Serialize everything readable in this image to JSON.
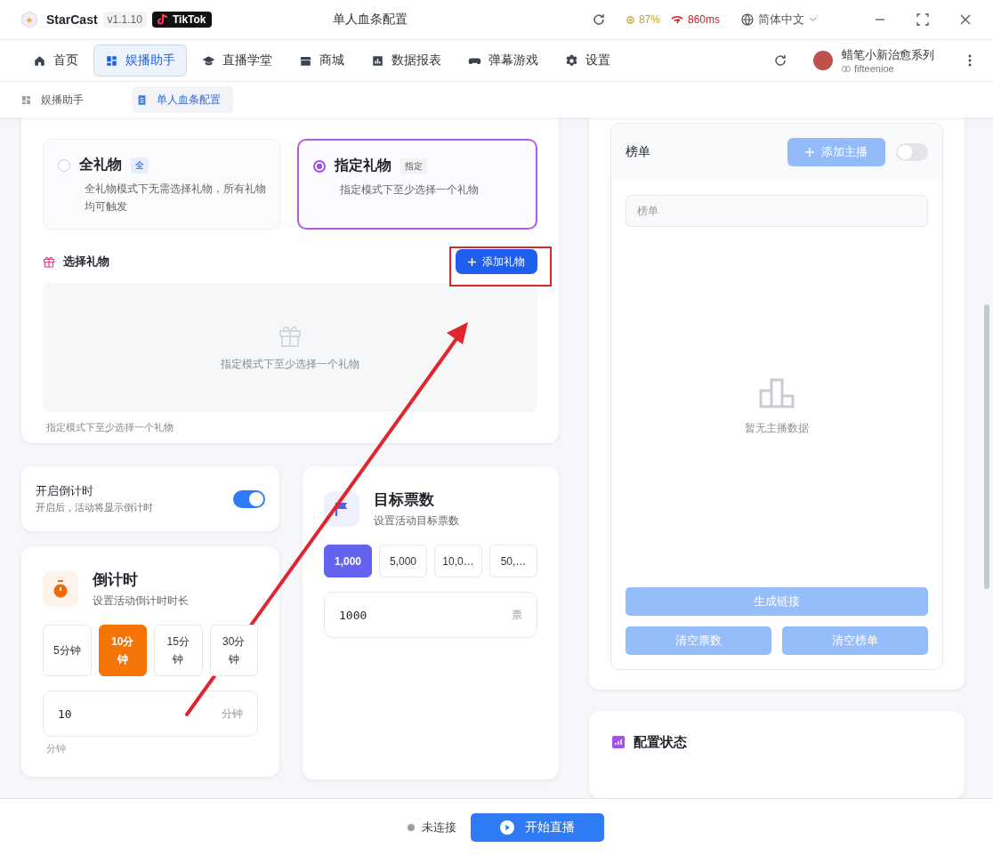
{
  "app": {
    "name": "StarCast",
    "version": "v1.1.10",
    "platform": "TikTok",
    "window_title": "单人血条配置",
    "battery": "87%",
    "latency": "860ms",
    "language": "简体中文"
  },
  "nav": {
    "items": [
      {
        "label": "首页",
        "selected": false
      },
      {
        "label": "娱播助手",
        "selected": true
      },
      {
        "label": "直播学堂",
        "selected": false
      },
      {
        "label": "商城",
        "selected": false
      },
      {
        "label": "数据报表",
        "selected": false
      },
      {
        "label": "弹幕游戏",
        "selected": false
      },
      {
        "label": "设置",
        "selected": false
      }
    ],
    "user": {
      "name": "蜡笔小新治愈系列",
      "handle": "fifteenioe"
    }
  },
  "tabs": [
    {
      "label": "娱播助手",
      "selected": false
    },
    {
      "label": "单人血条配置",
      "selected": true
    }
  ],
  "gift_mode": {
    "options": [
      {
        "title": "全礼物",
        "badge": "全",
        "description": "全礼物模式下无需选择礼物，所有礼物均可触发",
        "selected": false
      },
      {
        "title": "指定礼物",
        "badge": "指定",
        "description": "指定模式下至少选择一个礼物",
        "selected": true
      }
    ]
  },
  "gift_select": {
    "title": "选择礼物",
    "add_button": "添加礼物",
    "empty_text": "指定模式下至少选择一个礼物",
    "hint": "指定模式下至少选择一个礼物"
  },
  "countdown_toggle": {
    "label": "开启倒计时",
    "description": "开启后，活动将显示倒计时",
    "on": true
  },
  "countdown": {
    "title": "倒计时",
    "subtitle": "设置活动倒计时时长",
    "presets": [
      {
        "label": "5分钟",
        "selected": false
      },
      {
        "label": "10分钟",
        "selected": true
      },
      {
        "label": "15分钟",
        "selected": false
      },
      {
        "label": "30分钟",
        "selected": false
      }
    ],
    "value": "10",
    "unit": "分钟",
    "hint": "分钟"
  },
  "target": {
    "title": "目标票数",
    "subtitle": "设置活动目标票数",
    "presets": [
      {
        "label": "1,000",
        "selected": true
      },
      {
        "label": "5,000",
        "selected": false
      },
      {
        "label": "10,0…",
        "selected": false
      },
      {
        "label": "50,…",
        "selected": false
      }
    ],
    "value": "1000",
    "unit": "票"
  },
  "ranking": {
    "title": "榜单",
    "add_button": "添加主播",
    "toggle_on": false,
    "search_placeholder": "榜单",
    "empty_text": "暂无主播数据",
    "generate_button": "生成链接",
    "clear_votes_button": "清空票数",
    "clear_list_button": "清空榜单"
  },
  "config_status": {
    "title": "配置状态"
  },
  "footer": {
    "status": "未连接",
    "start_button": "开始直播"
  }
}
